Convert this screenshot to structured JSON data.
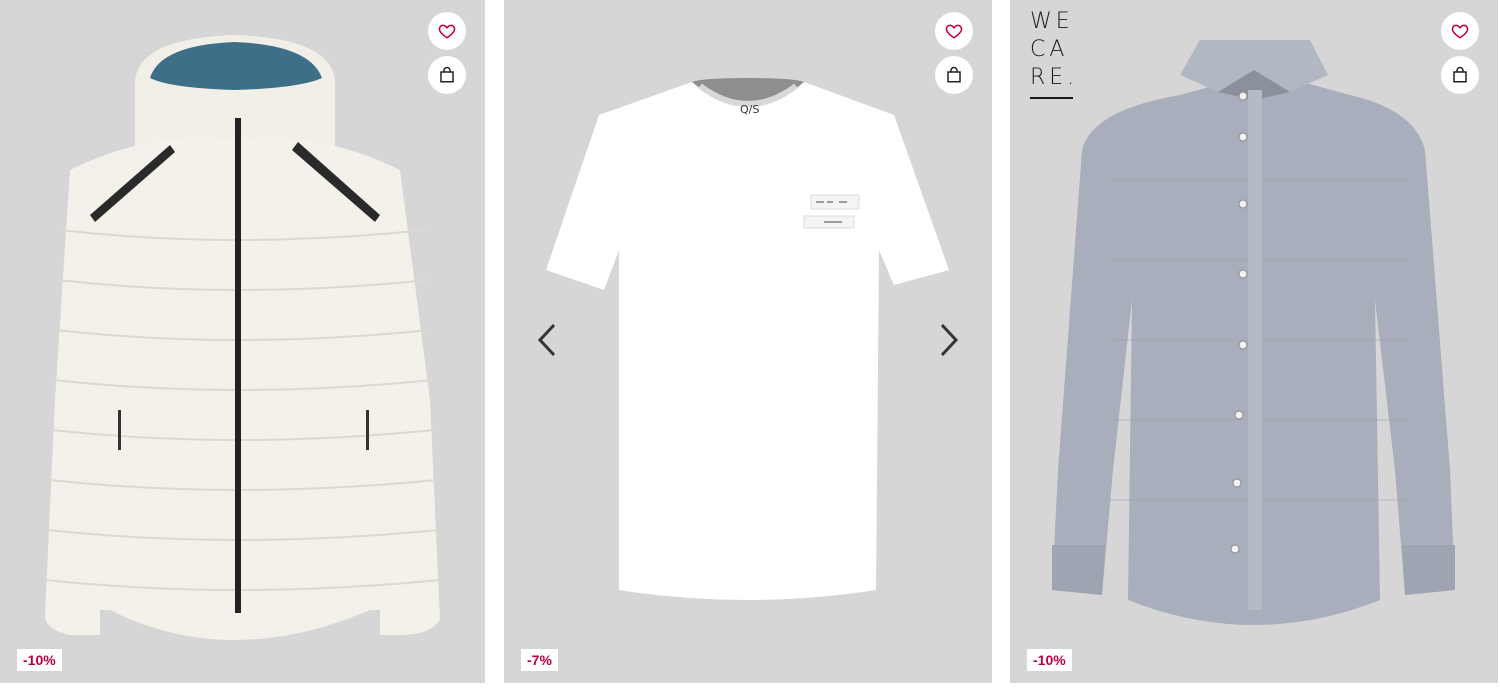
{
  "colors": {
    "card_background": "#d6d6d6",
    "badge_text": "#c0003c",
    "heart_icon": "#c0003c",
    "icon_dark": "#222222"
  },
  "products": [
    {
      "name": "jacket",
      "image_icon": "white-puffer-jacket",
      "discount": "-10%",
      "favorite_icon": "heart-icon",
      "cart_icon": "shopping-bag-icon"
    },
    {
      "name": "tshirt",
      "image_icon": "white-tshirt",
      "discount": "-7%",
      "favorite_icon": "heart-icon",
      "cart_icon": "shopping-bag-icon",
      "carousel_prev_icon": "chevron-left-icon",
      "carousel_next_icon": "chevron-right-icon"
    },
    {
      "name": "shirt",
      "image_icon": "grey-dress-shirt",
      "discount": "-10%",
      "favorite_icon": "heart-icon",
      "cart_icon": "shopping-bag-icon",
      "brand_lines": [
        "WE",
        "CA",
        "RE."
      ]
    }
  ]
}
